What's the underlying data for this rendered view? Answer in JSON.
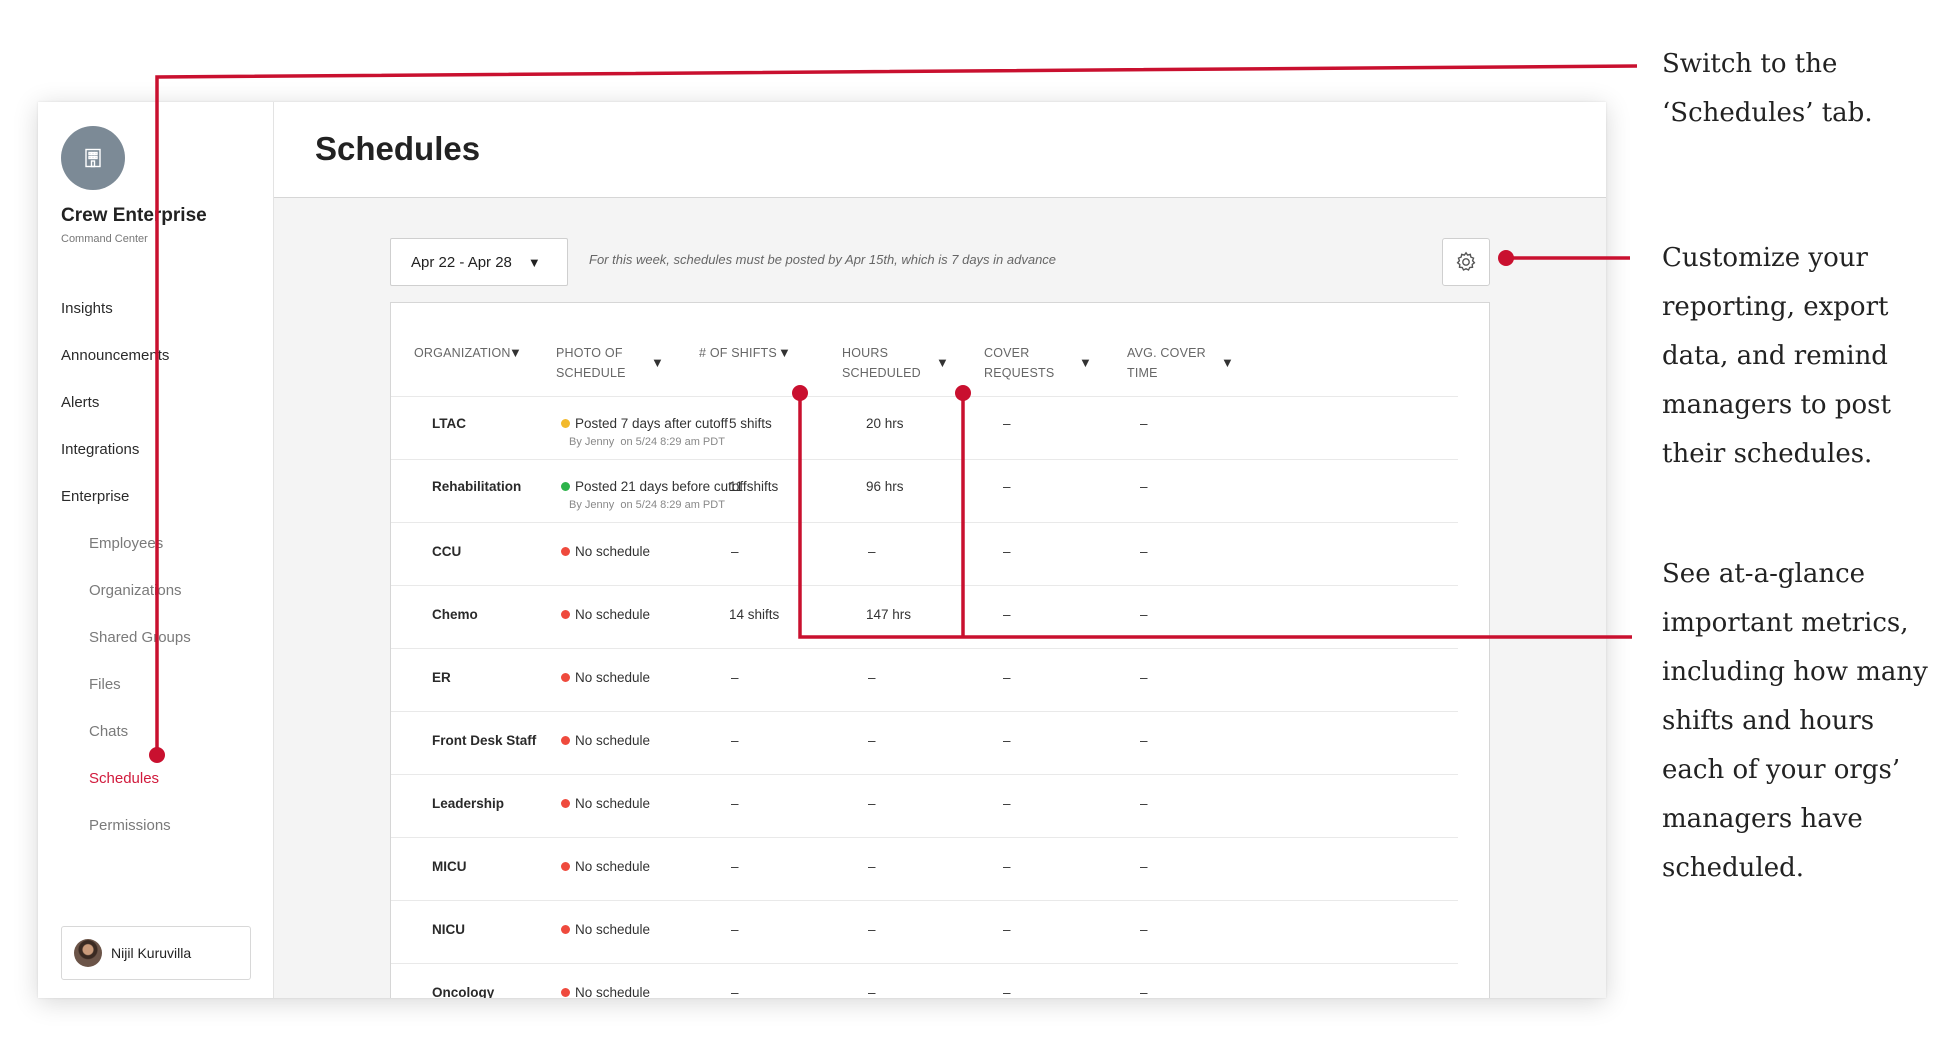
{
  "sidebar": {
    "org_name": "Crew Enterprise",
    "org_subtitle": "Command Center",
    "items": [
      {
        "label": "Insights"
      },
      {
        "label": "Announcements"
      },
      {
        "label": "Alerts"
      },
      {
        "label": "Integrations"
      },
      {
        "label": "Enterprise"
      },
      {
        "label": "Employees"
      },
      {
        "label": "Organizations"
      },
      {
        "label": "Shared Groups"
      },
      {
        "label": "Files"
      },
      {
        "label": "Chats"
      },
      {
        "label": "Schedules",
        "active": true
      },
      {
        "label": "Permissions"
      }
    ],
    "user_name": "Nijil Kuruvilla"
  },
  "header": {
    "title": "Schedules"
  },
  "toolbar": {
    "date_range": "Apr 22 - Apr 28",
    "note": "For this week, schedules must be posted by Apr 15th, which is 7 days in advance"
  },
  "table": {
    "columns": [
      {
        "label": "ORGANIZATION"
      },
      {
        "label": "PHOTO OF SCHEDULE"
      },
      {
        "label": "# OF SHIFTS"
      },
      {
        "label": "HOURS SCHEDULED"
      },
      {
        "label": "COVER REQUESTS"
      },
      {
        "label": "AVG. COVER TIME"
      }
    ],
    "rows": [
      {
        "org": "LTAC",
        "status": "Posted 7 days after cutoff",
        "status_color": "#f2b92c",
        "by": "By Jenny",
        "on": "on 5/24 8:29 am PDT",
        "shifts": "5 shifts",
        "hours": "20 hrs",
        "cover": "–",
        "avg": "–"
      },
      {
        "org": "Rehabilitation",
        "status": "Posted 21 days before cutoff",
        "status_color": "#2db34a",
        "by": "By Jenny",
        "on": "on 5/24 8:29 am PDT",
        "shifts": "11 shifts",
        "hours": "96 hrs",
        "cover": "–",
        "avg": "–"
      },
      {
        "org": "CCU",
        "status": "No schedule",
        "status_color": "#ef4a3d",
        "shifts": "–",
        "hours": "–",
        "cover": "–",
        "avg": "–"
      },
      {
        "org": "Chemo",
        "status": "No schedule",
        "status_color": "#ef4a3d",
        "shifts": "14 shifts",
        "hours": "147 hrs",
        "cover": "–",
        "avg": "–"
      },
      {
        "org": "ER",
        "status": "No schedule",
        "status_color": "#ef4a3d",
        "shifts": "–",
        "hours": "–",
        "cover": "–",
        "avg": "–"
      },
      {
        "org": "Front Desk Staff",
        "status": "No schedule",
        "status_color": "#ef4a3d",
        "shifts": "–",
        "hours": "–",
        "cover": "–",
        "avg": "–"
      },
      {
        "org": "Leadership",
        "status": "No schedule",
        "status_color": "#ef4a3d",
        "shifts": "–",
        "hours": "–",
        "cover": "–",
        "avg": "–"
      },
      {
        "org": "MICU",
        "status": "No schedule",
        "status_color": "#ef4a3d",
        "shifts": "–",
        "hours": "–",
        "cover": "–",
        "avg": "–"
      },
      {
        "org": "NICU",
        "status": "No schedule",
        "status_color": "#ef4a3d",
        "shifts": "–",
        "hours": "–",
        "cover": "–",
        "avg": "–"
      },
      {
        "org": "Oncology",
        "status": "No schedule",
        "status_color": "#ef4a3d",
        "shifts": "–",
        "hours": "–",
        "cover": "–",
        "avg": "–"
      }
    ]
  },
  "annotations": {
    "tab": "Switch to the ‘Schedules’ tab.",
    "settings": "Customize your reporting, export data, and remind managers to post their schedules.",
    "metrics": "See at-a-glance important metrics, including how many shifts and hours each of your orgs’ managers have scheduled."
  },
  "colors": {
    "accent": "#d11a3c",
    "posted_late": "#f2b92c",
    "posted_early": "#2db34a",
    "no_schedule": "#ef4a3d"
  },
  "icons": {
    "org_avatar": "building-icon",
    "settings": "gear-icon",
    "sort": "sort-caret-icon",
    "date": "chevron-down-icon"
  }
}
